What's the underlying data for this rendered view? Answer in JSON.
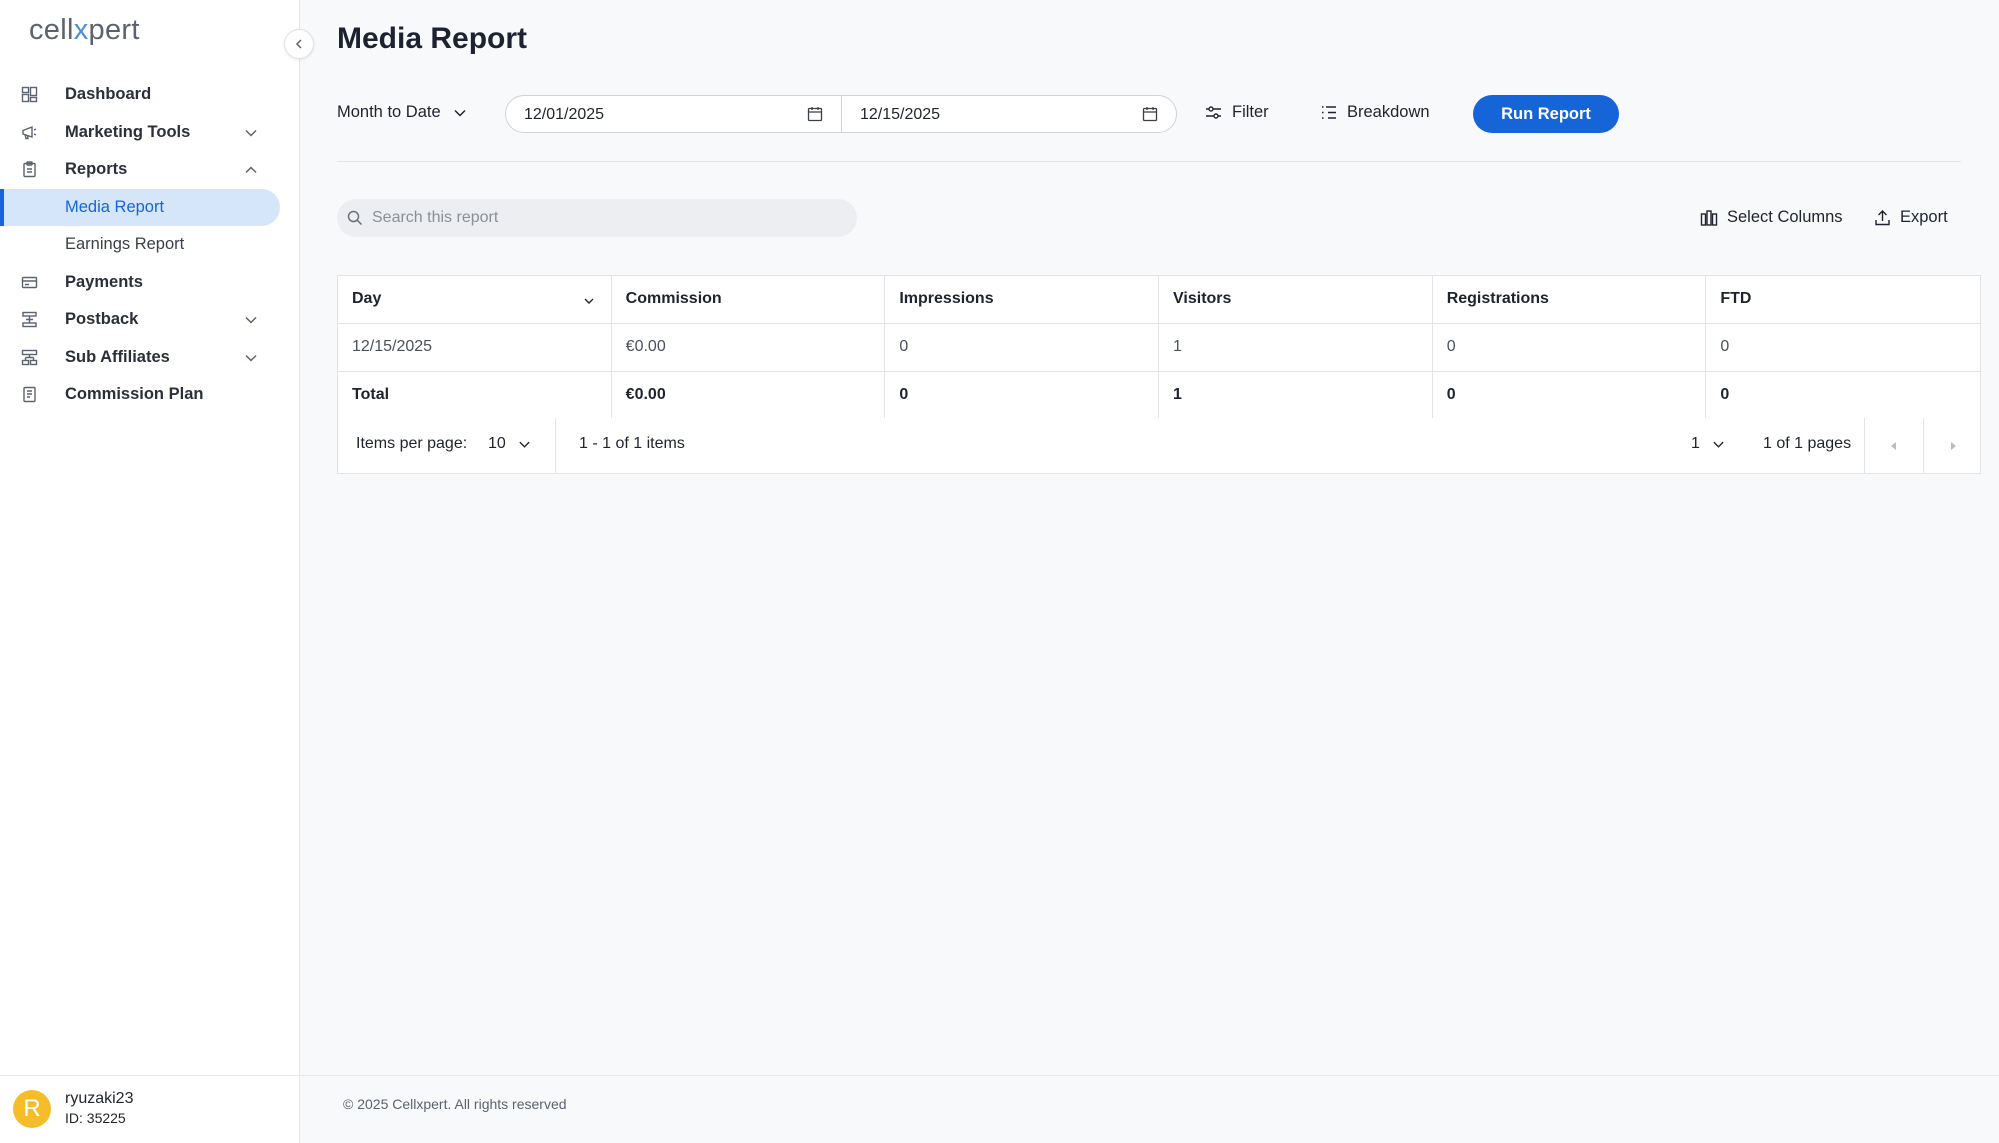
{
  "app": {
    "logo_pre": "cell",
    "logo_x": "x",
    "logo_post": "pert"
  },
  "sidebar": {
    "items": [
      {
        "label": "Dashboard",
        "icon": "dashboard-icon"
      },
      {
        "label": "Marketing Tools",
        "icon": "megaphone-icon"
      },
      {
        "label": "Reports",
        "icon": "clipboard-icon"
      },
      {
        "label": "Media Report"
      },
      {
        "label": "Earnings Report"
      },
      {
        "label": "Payments",
        "icon": "card-icon"
      },
      {
        "label": "Postback",
        "icon": "postback-icon"
      },
      {
        "label": "Sub Affiliates",
        "icon": "sub-affiliates-icon"
      },
      {
        "label": "Commission Plan",
        "icon": "document-icon"
      }
    ]
  },
  "user": {
    "initial": "R",
    "name": "ryuzaki23",
    "id": "ID: 35225"
  },
  "page": {
    "title": "Media Report"
  },
  "toolbar": {
    "range": "Month to Date",
    "date_from": "12/01/2025",
    "date_to": "12/15/2025",
    "filter": "Filter",
    "breakdown": "Breakdown",
    "run": "Run Report"
  },
  "search": {
    "placeholder": "Search this report"
  },
  "actions": {
    "select_columns": "Select Columns",
    "export": "Export"
  },
  "table": {
    "headers": [
      "Day",
      "Commission",
      "Impressions",
      "Visitors",
      "Registrations",
      "FTD"
    ],
    "rows": [
      [
        "12/15/2025",
        "€0.00",
        "0",
        "1",
        "0",
        "0"
      ]
    ],
    "total": [
      "Total",
      "€0.00",
      "0",
      "1",
      "0",
      "0"
    ]
  },
  "pager": {
    "items_per_page_label": "Items per page:",
    "items_per_page": "10",
    "count": "1 - 1 of 1 items",
    "page": "1",
    "pages": "1 of 1 pages"
  },
  "footer": {
    "copyright": "© 2025 Cellxpert. All rights reserved"
  },
  "colors": {
    "accent": "#1565d8",
    "active_bg": "#d5e6fb",
    "avatar": "#f5bd2a"
  }
}
